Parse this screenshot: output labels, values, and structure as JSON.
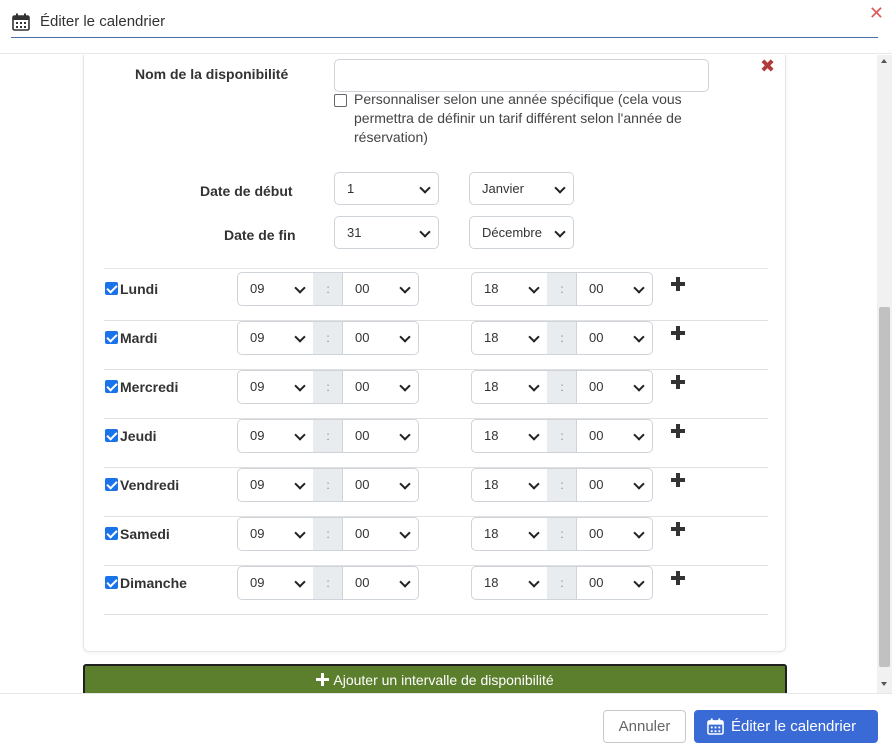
{
  "header": {
    "title": "Éditer le calendrier",
    "close_glyph": "✕"
  },
  "form": {
    "card_close_glyph": "✖",
    "name_label": "Nom de la disponibilité",
    "name_value": "",
    "customize_label": "Personnaliser selon une année spécifique (cela vous permettra de définir un tarif différent selon l'année de réservation)",
    "customize_checked": false,
    "start_label": "Date de début",
    "start_day": "1",
    "start_month": "Janvier",
    "end_label": "Date de fin",
    "end_day": "31",
    "end_month": "Décembre"
  },
  "days": [
    {
      "name": "Lundi",
      "checked": true,
      "start_h": "09",
      "start_m": "00",
      "end_h": "18",
      "end_m": "00"
    },
    {
      "name": "Mardi",
      "checked": true,
      "start_h": "09",
      "start_m": "00",
      "end_h": "18",
      "end_m": "00"
    },
    {
      "name": "Mercredi",
      "checked": true,
      "start_h": "09",
      "start_m": "00",
      "end_h": "18",
      "end_m": "00"
    },
    {
      "name": "Jeudi",
      "checked": true,
      "start_h": "09",
      "start_m": "00",
      "end_h": "18",
      "end_m": "00"
    },
    {
      "name": "Vendredi",
      "checked": true,
      "start_h": "09",
      "start_m": "00",
      "end_h": "18",
      "end_m": "00"
    },
    {
      "name": "Samedi",
      "checked": true,
      "start_h": "09",
      "start_m": "00",
      "end_h": "18",
      "end_m": "00"
    },
    {
      "name": "Dimanche",
      "checked": true,
      "start_h": "09",
      "start_m": "00",
      "end_h": "18",
      "end_m": "00"
    }
  ],
  "time_separator": ":",
  "add_interval_label": "Ajouter un intervalle de disponibilité",
  "footer": {
    "cancel_label": "Annuler",
    "submit_label": "Éditer le calendrier"
  },
  "icons": {
    "header": "calendar-icon",
    "submit": "calendar-icon",
    "add_time": "plus-icon"
  },
  "colors": {
    "accent": "#3a6ad6",
    "add_button": "#5c7f2e",
    "close": "#e05a5a",
    "checkbox": "#1a73e8"
  }
}
